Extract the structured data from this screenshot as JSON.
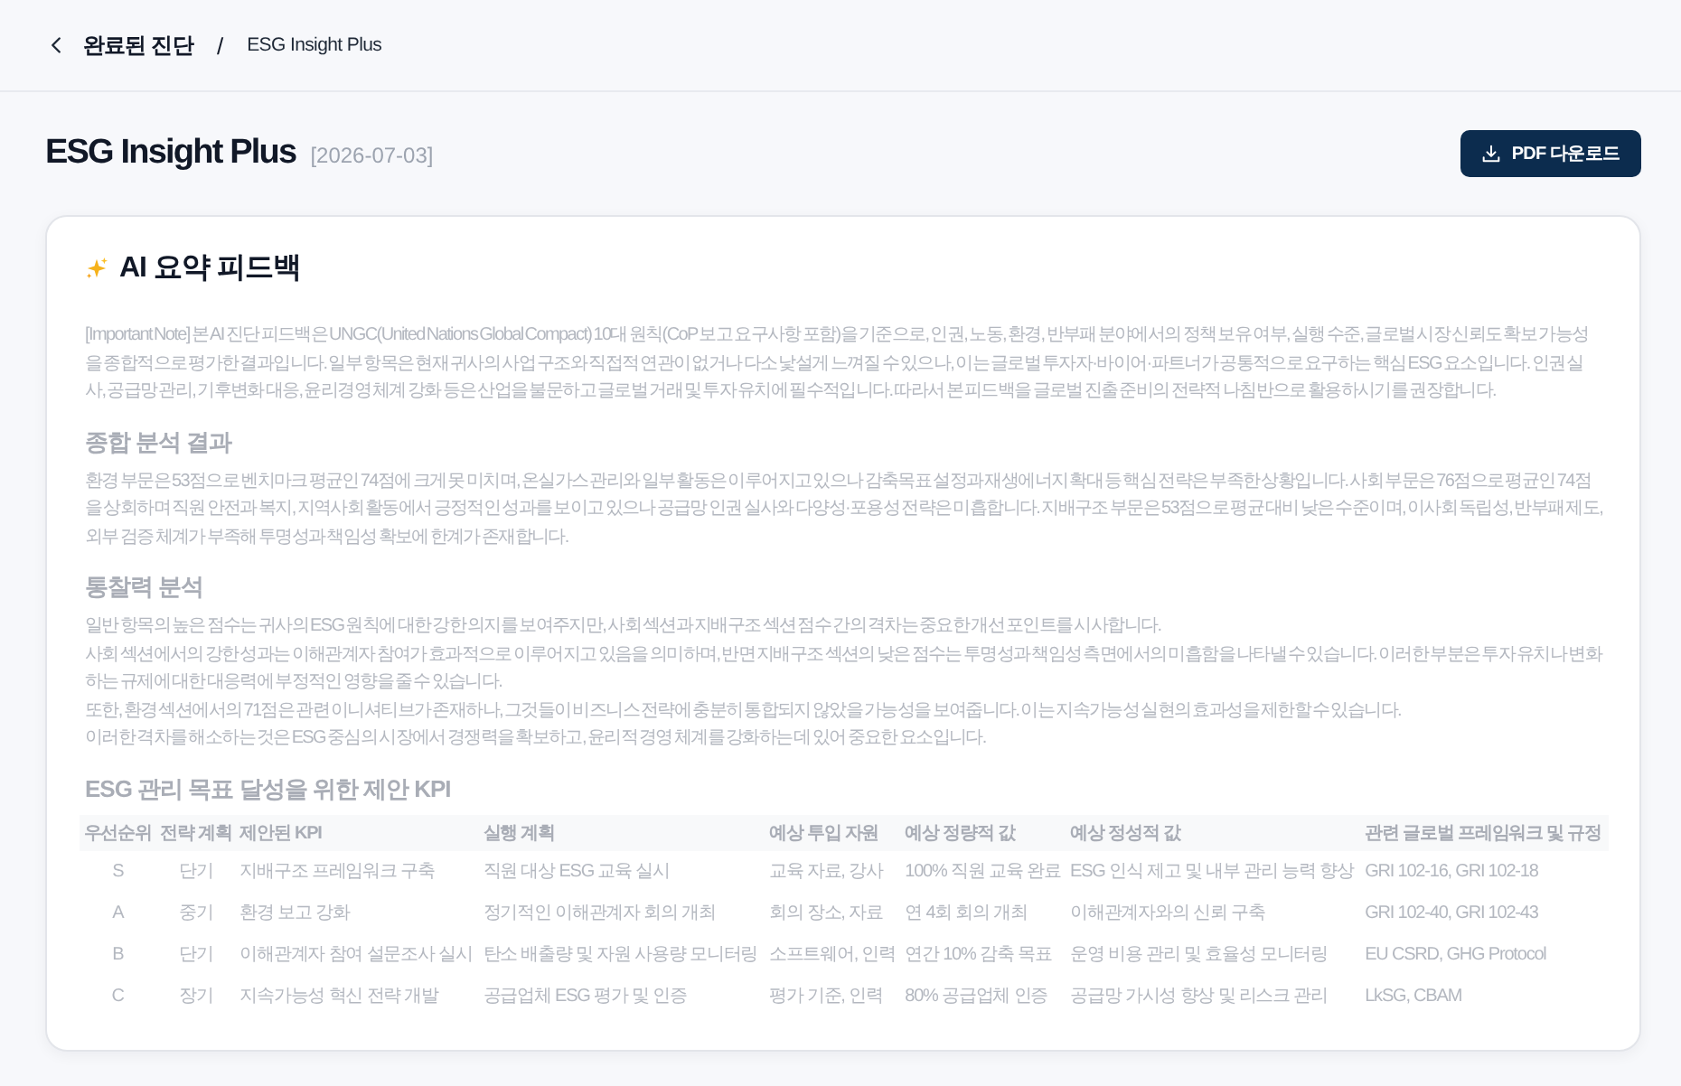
{
  "breadcrumb": {
    "back_label": "완료된 진단",
    "separator": "/",
    "current": "ESG Insight Plus"
  },
  "header": {
    "title": "ESG Insight Plus",
    "date": "[2026-07-03]",
    "download_button": "PDF 다운로드"
  },
  "feedback": {
    "title": "AI 요약 피드백",
    "dimmed": true,
    "intro": "[Important Note] 본 AI 진단 피드백은 UNGC(United Nations Global Compact) 10대 원칙(CoP 보고 요구사항 포함)을 기준으로, 인권, 노동, 환경, 반부패 분야에서의 정책 보유 여부, 실행 수준, 글로벌 시장 신뢰도 확보 가능성을 종합적으로 평가한 결과입니다. 일부 항목은 현재 귀사의 사업 구조와 직접적 연관이 없거나 다소 낯설게 느껴질 수 있으나, 이는 글로벌 투자자·바이어·파트너가 공통적으로 요구하는 핵심 ESG 요소입니다. 인권 실사, 공급망 관리, 기후변화 대응, 윤리경영 체계 강화 등은 산업을 불문하고 글로벌 거래 및 투자 유치에 필수적입니다. 따라서 본 피드백을 글로벌 진출 준비의 전략적 나침반으로 활용하시기를 권장합니다.",
    "sections": [
      {
        "kind": "text",
        "heading": "종합 분석 결과",
        "paragraphs": [
          "환경 부문은 53점으로 벤치마크 평균인 74점에 크게 못 미치며, 온실가스 관리와 일부 활동은 이루어지고 있으나 감축목표 설정과 재생에너지 확대 등 핵심 전략은 부족한 상황입니다. 사회 부문은 76점으로 평균인 74점을 상회하며 직원 안전과 복지, 지역사회 활동에서 긍정적인 성과를 보이고 있으나 공급망 인권 실사와 다양성·포용성 전략은 미흡합니다. 지배구조 부문은 53점으로 평균 대비 낮은 수준이며, 이사회 독립성, 반부패 제도, 외부 검증 체계가 부족해 투명성과 책임성 확보에 한계가 존재합니다."
        ]
      },
      {
        "kind": "text",
        "heading": "통찰력 분석",
        "paragraphs": [
          "일반 항목의 높은 점수는 귀사의 ESG 원칙에 대한 강한 의지를 보여주지만, 사회 섹션과 지배구조 섹션 점수 간의 격차는 중요한 개선 포인트를 시사합니다.",
          "사회 섹션에서의 강한 성과는 이해관계자 참여가 효과적으로 이루어지고 있음을 의미하며, 반면 지배구조 섹션의 낮은 점수는 투명성과 책임성 측면에서의 미흡함을 나타낼 수 있습니다. 이러한 부분은 투자 유치나 변화하는 규제에 대한 대응력에 부정적인 영향을 줄 수 있습니다.",
          "또한, 환경 섹션에서의 71점은 관련 이니셔티브가 존재하나, 그것들이 비즈니스 전략에 충분히 통합되지 않았을 가능성을 보여줍니다. 이는 지속가능성 실현의 효과성을 제한할 수 있습니다.",
          "이러한 격차를 해소하는 것은 ESG 중심의 시장에서 경쟁력을 확보하고, 윤리적 경영 체계를 강화하는 데 있어 중요한 요소입니다."
        ]
      },
      {
        "kind": "table",
        "heading": "ESG 관리 목표 달성을 위한 제안 KPI",
        "table": {
          "columns": [
            "우선순위",
            "전략 계획",
            "제안된 KPI",
            "실행 계획",
            "예상 투입 자원",
            "예상 정량적 값",
            "예상 정성적 값",
            "관련 글로벌 프레임워크 및 규정"
          ],
          "rows": [
            [
              "S",
              "단기",
              "지배구조 프레임워크 구축",
              "직원 대상 ESG 교육 실시",
              "교육 자료, 강사",
              "100% 직원 교육 완료",
              "ESG 인식 제고 및 내부 관리 능력 향상",
              "GRI 102-16, GRI 102-18"
            ],
            [
              "A",
              "중기",
              "환경 보고 강화",
              "정기적인 이해관계자 회의 개최",
              "회의 장소, 자료",
              "연 4회 회의 개최",
              "이해관계자와의 신뢰 구축",
              "GRI 102-40, GRI 102-43"
            ],
            [
              "B",
              "단기",
              "이해관계자 참여 설문조사 실시",
              "탄소 배출량 및 자원 사용량 모니터링",
              "소프트웨어, 인력",
              "연간 10% 감축 목표",
              "운영 비용 관리 및 효율성 모니터링",
              "EU CSRD, GHG Protocol"
            ],
            [
              "C",
              "장기",
              "지속가능성 혁신 전략 개발",
              "공급업체 ESG 평가 및 인증",
              "평가 기준, 인력",
              "80% 공급업체 인증",
              "공급망 가시성 향상 및 리스크 관리",
              "LkSG, CBAM"
            ]
          ]
        }
      }
    ]
  }
}
